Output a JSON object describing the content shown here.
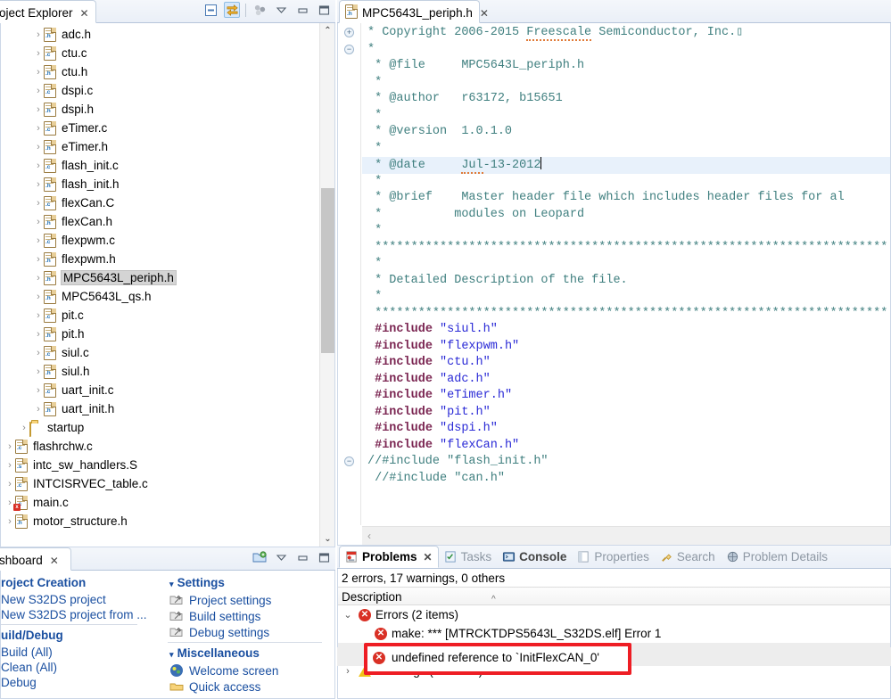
{
  "project_explorer": {
    "tab_label": "oject Explorer",
    "tab_close": "✕",
    "toolbar": [
      {
        "name": "collapse-all-icon",
        "glyph": "▤"
      },
      {
        "name": "link-with-editor-icon",
        "glyph": "⇄"
      },
      {
        "name": "view-menu-group-icon",
        "glyph": "❖"
      },
      {
        "name": "view-menu-icon",
        "glyph": "▽"
      },
      {
        "name": "minimize-icon",
        "glyph": "▭"
      },
      {
        "name": "maximize-icon",
        "glyph": "❐"
      }
    ],
    "tree": [
      {
        "label": "adc.h",
        "icon": "h",
        "indent": 2,
        "selected": false
      },
      {
        "label": "ctu.c",
        "icon": "c",
        "indent": 2,
        "selected": false
      },
      {
        "label": "ctu.h",
        "icon": "h",
        "indent": 2,
        "selected": false
      },
      {
        "label": "dspi.c",
        "icon": "c",
        "indent": 2,
        "selected": false
      },
      {
        "label": "dspi.h",
        "icon": "h",
        "indent": 2,
        "selected": false
      },
      {
        "label": "eTimer.c",
        "icon": "c",
        "indent": 2,
        "selected": false
      },
      {
        "label": "eTimer.h",
        "icon": "h",
        "indent": 2,
        "selected": false
      },
      {
        "label": "flash_init.c",
        "icon": "c",
        "indent": 2,
        "selected": false
      },
      {
        "label": "flash_init.h",
        "icon": "h",
        "indent": 2,
        "selected": false
      },
      {
        "label": "flexCan.C",
        "icon": "c",
        "indent": 2,
        "selected": false
      },
      {
        "label": "flexCan.h",
        "icon": "h",
        "indent": 2,
        "selected": false
      },
      {
        "label": "flexpwm.c",
        "icon": "c",
        "indent": 2,
        "selected": false
      },
      {
        "label": "flexpwm.h",
        "icon": "h",
        "indent": 2,
        "selected": false
      },
      {
        "label": "MPC5643L_periph.h",
        "icon": "h",
        "indent": 2,
        "selected": true
      },
      {
        "label": "MPC5643L_qs.h",
        "icon": "h",
        "indent": 2,
        "selected": false
      },
      {
        "label": "pit.c",
        "icon": "c",
        "indent": 2,
        "selected": false
      },
      {
        "label": "pit.h",
        "icon": "h",
        "indent": 2,
        "selected": false
      },
      {
        "label": "siul.c",
        "icon": "c",
        "indent": 2,
        "selected": false
      },
      {
        "label": "siul.h",
        "icon": "h",
        "indent": 2,
        "selected": false
      },
      {
        "label": "uart_init.c",
        "icon": "c",
        "indent": 2,
        "selected": false
      },
      {
        "label": "uart_init.h",
        "icon": "h",
        "indent": 2,
        "selected": false
      },
      {
        "label": "startup",
        "icon": "folder",
        "indent": 1,
        "selected": false
      },
      {
        "label": "flashrchw.c",
        "icon": "c",
        "indent": 0,
        "selected": false
      },
      {
        "label": "intc_sw_handlers.S",
        "icon": "s",
        "indent": 0,
        "selected": false
      },
      {
        "label": "INTCISRVEC_table.c",
        "icon": "c",
        "indent": 0,
        "selected": false
      },
      {
        "label": "main.c",
        "icon": "c-error",
        "indent": 0,
        "selected": false
      },
      {
        "label": "motor_structure.h",
        "icon": "h",
        "indent": 0,
        "selected": false
      }
    ]
  },
  "dashboard": {
    "tab_label": "shboard",
    "tab_close": "✕",
    "toolbar": [
      {
        "name": "import-project-icon",
        "glyph": "📥"
      },
      {
        "name": "view-menu-icon",
        "glyph": "▽"
      },
      {
        "name": "minimize-icon",
        "glyph": "▭"
      },
      {
        "name": "maximize-icon",
        "glyph": "❐"
      }
    ],
    "left_sections": [
      {
        "title": "roject Creation",
        "items": [
          {
            "label": "New S32DS project"
          },
          {
            "label": "New S32DS project from ..."
          }
        ]
      },
      {
        "title": "uild/Debug",
        "items": [
          {
            "label": "Build  (All)"
          },
          {
            "label": "Clean  (All)"
          },
          {
            "label": "Debug"
          }
        ]
      }
    ],
    "right_sections": [
      {
        "title": "Settings",
        "twisty": "▾",
        "items": [
          {
            "label": "Project settings",
            "icon": "project-settings-icon"
          },
          {
            "label": "Build settings",
            "icon": "build-settings-icon"
          },
          {
            "label": "Debug settings",
            "icon": "debug-settings-icon"
          }
        ]
      },
      {
        "title": "Miscellaneous",
        "twisty": "▾",
        "items": [
          {
            "label": "Welcome screen",
            "icon": "welcome-screen-icon"
          },
          {
            "label": "Quick access",
            "icon": "quick-access-icon"
          }
        ]
      }
    ]
  },
  "editor": {
    "tab_label": "MPC5643L_periph.h",
    "tab_close": "✕",
    "code_lines": [
      {
        "fold": "plus",
        "html": "<span class=\"cmt\">* Copyright 2006-2015 <span class=\"squiggle\">Freescale</span> Semiconductor, Inc.▯</span>"
      },
      {
        "fold": "minus",
        "html": "<span class=\"cmt\">*</span>"
      },
      {
        "fold": "",
        "html": "<span class=\"cmt\"> * @file     MPC5643L_periph.h</span>"
      },
      {
        "fold": "",
        "html": "<span class=\"cmt\"> *</span>"
      },
      {
        "fold": "",
        "html": "<span class=\"cmt\"> * @author   r63172, b15651</span>"
      },
      {
        "fold": "",
        "html": "<span class=\"cmt\"> *</span>"
      },
      {
        "fold": "",
        "html": "<span class=\"cmt\"> * @version  1.0.1.0</span>"
      },
      {
        "fold": "",
        "html": "<span class=\"cmt\"> *</span>"
      },
      {
        "fold": "",
        "hl": true,
        "html": "<span class=\"cmt\"> * @date     <span class=\"squiggle\">Jul</span>-13-2012</span><span class=\"caret\"></span>"
      },
      {
        "fold": "",
        "html": "<span class=\"cmt\"> *</span>"
      },
      {
        "fold": "",
        "html": "<span class=\"cmt\"> * @brief    Master header file which includes header files for al</span>"
      },
      {
        "fold": "",
        "html": "<span class=\"cmt\"> *          modules on Leopard</span>"
      },
      {
        "fold": "",
        "html": "<span class=\"cmt\"> *</span>"
      },
      {
        "fold": "",
        "html": "<span class=\"cmt\"> ***********************************************************************</span>"
      },
      {
        "fold": "",
        "html": "<span class=\"cmt\"> *</span>"
      },
      {
        "fold": "",
        "html": "<span class=\"cmt\"> * Detailed Description of the file.</span>"
      },
      {
        "fold": "",
        "html": "<span class=\"cmt\"> *</span>"
      },
      {
        "fold": "",
        "html": "<span class=\"cmt\"> ***********************************************************************</span>"
      },
      {
        "fold": "",
        "html": " <span class=\"pp\">#include</span> <span class=\"str\">\"siul.h\"</span>"
      },
      {
        "fold": "",
        "html": " <span class=\"pp\">#include</span> <span class=\"str\">\"flexpwm.h\"</span>"
      },
      {
        "fold": "",
        "html": " <span class=\"pp\">#include</span> <span class=\"str\">\"ctu.h\"</span>"
      },
      {
        "fold": "",
        "html": " <span class=\"pp\">#include</span> <span class=\"str\">\"adc.h\"</span>"
      },
      {
        "fold": "",
        "html": " <span class=\"pp\">#include</span> <span class=\"str\">\"eTimer.h\"</span>"
      },
      {
        "fold": "",
        "html": " <span class=\"pp\">#include</span> <span class=\"str\">\"pit.h\"</span>"
      },
      {
        "fold": "",
        "html": " <span class=\"pp\">#include</span> <span class=\"str\">\"dspi.h\"</span>"
      },
      {
        "fold": "",
        "html": " <span class=\"pp\">#include</span> <span class=\"str\">\"flexCan.h\"</span>"
      },
      {
        "fold": "minus",
        "html": "<span class=\"cmt-slash\">//#include \"flash_init.h\"</span>"
      },
      {
        "fold": "",
        "html": " <span class=\"cmt-slash\">//#include \"can.h\"</span>"
      }
    ]
  },
  "problems": {
    "tabs": [
      {
        "label": "Problems",
        "icon": "problems-icon",
        "active": true,
        "closable": true
      },
      {
        "label": "Tasks",
        "icon": "tasks-icon",
        "active": false
      },
      {
        "label": "Console",
        "icon": "console-icon",
        "active": false,
        "bold": true
      },
      {
        "label": "Properties",
        "icon": "properties-icon",
        "active": false
      },
      {
        "label": "Search",
        "icon": "search-icon",
        "active": false
      },
      {
        "label": "Problem Details",
        "icon": "problem-details-icon",
        "active": false
      }
    ],
    "tab_close": "✕",
    "summary": "2 errors, 17 warnings, 0 others",
    "column_header": "Description",
    "sort_caret": "^",
    "rows": [
      {
        "twisty": "⌄",
        "icon": "error",
        "label": "Errors (2 items)",
        "indent": 0,
        "selected": false
      },
      {
        "twisty": "",
        "icon": "error",
        "label": "make: *** [MTRCKTDPS5643L_S32DS.elf] Error 1",
        "indent": 1,
        "selected": false,
        "covered": true
      },
      {
        "twisty": "",
        "icon": "error",
        "label": "undefined reference to `InitFlexCAN_0'",
        "indent": 1,
        "selected": true,
        "highlighted": true
      },
      {
        "twisty": "›",
        "icon": "warn",
        "label": "Warnings (17 items)",
        "indent": 0,
        "selected": false,
        "covered": true
      }
    ],
    "annotation_color": "#ee1d24"
  },
  "colors": {
    "accent_blue": "#1a4fa0",
    "error_red": "#d93025",
    "annotation_red": "#ee1d24",
    "comment_green": "#3f7f7f",
    "preproc_purple": "#7b2652",
    "string_blue": "#2a2ad6",
    "selection_blue": "#e8f1fb"
  }
}
